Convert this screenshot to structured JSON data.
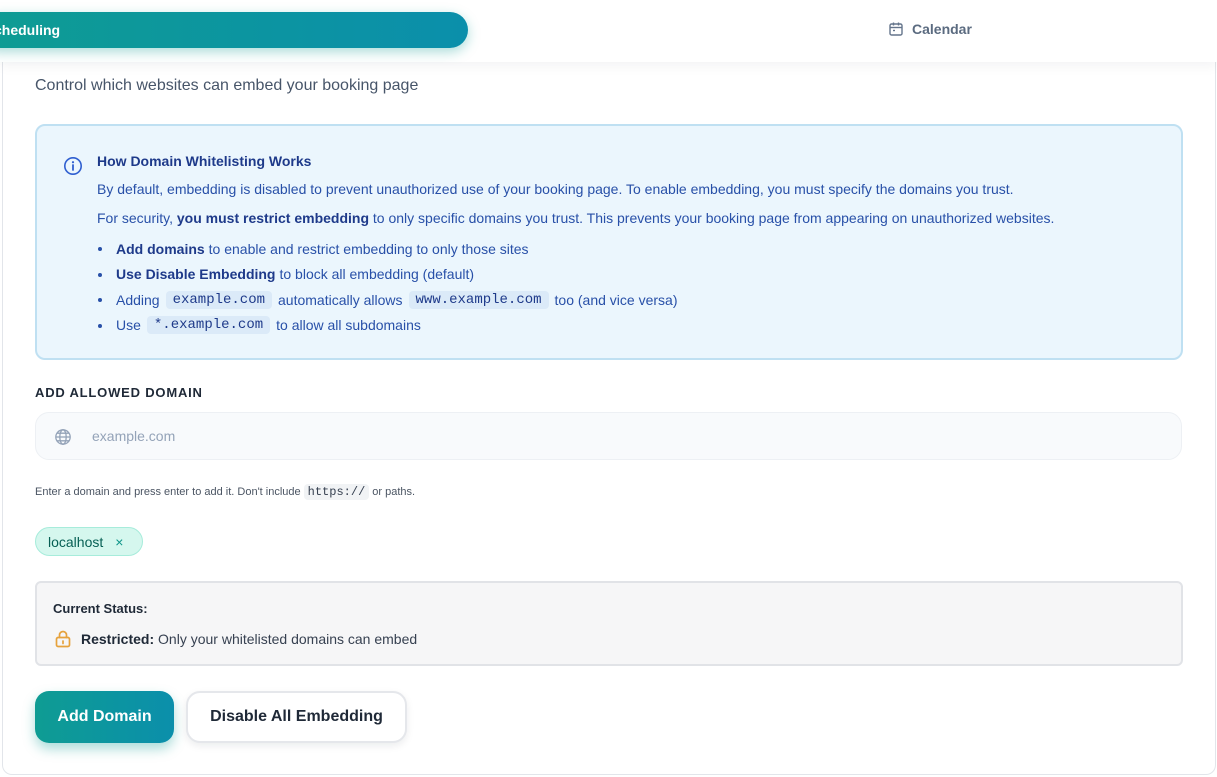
{
  "nav": {
    "active_tab": "cheduling",
    "tabs": [
      {
        "label": "Calendar",
        "icon": "calendar-icon"
      }
    ]
  },
  "page": {
    "subtitle": "Control which websites can embed your booking page"
  },
  "info": {
    "icon": "info-icon",
    "title": "How Domain Whitelisting Works",
    "line1": "By default, embedding is disabled to prevent unauthorized use of your booking page. To enable embedding, you must specify the domains you trust.",
    "line2_prefix": "For security,",
    "line2_bold": "you must restrict embedding",
    "line2_suffix": "to only specific domains you trust. This prevents your booking page from appearing on unauthorized websites.",
    "bullets": {
      "b1_bold": "Add domains",
      "b1_text": "to enable and restrict embedding to only those sites",
      "b2_bold": "Use Disable Embedding",
      "b2_text": "to block all embedding (default)",
      "b3_prefix": "Adding",
      "b3_code1": "example.com",
      "b3_mid": "automatically allows",
      "b3_code2": "www.example.com",
      "b3_suffix": "too (and vice versa)",
      "b4_prefix": "Use",
      "b4_code": "*.example.com",
      "b4_suffix": "to allow all subdomains"
    }
  },
  "add_domain": {
    "label": "ADD ALLOWED DOMAIN",
    "placeholder": "example.com",
    "value": "",
    "hint_prefix": "Enter a domain and press enter to add it. Don't include",
    "hint_code": "https://",
    "hint_suffix": "or paths."
  },
  "domains": [
    {
      "name": "localhost",
      "remove": "×"
    }
  ],
  "status": {
    "title": "Current Status:",
    "icon": "lock-icon",
    "bold": "Restricted:",
    "text": "Only your whitelisted domains can embed"
  },
  "actions": {
    "add_label": "Add Domain",
    "disable_label": "Disable All Embedding"
  },
  "colors": {
    "accent_start": "#0e9c93",
    "accent_end": "#0b8fab",
    "info_bg": "#ebf6fd",
    "info_text": "#1e3a8a",
    "chip_bg": "#d5f7ee",
    "lock": "#e6a23c"
  }
}
